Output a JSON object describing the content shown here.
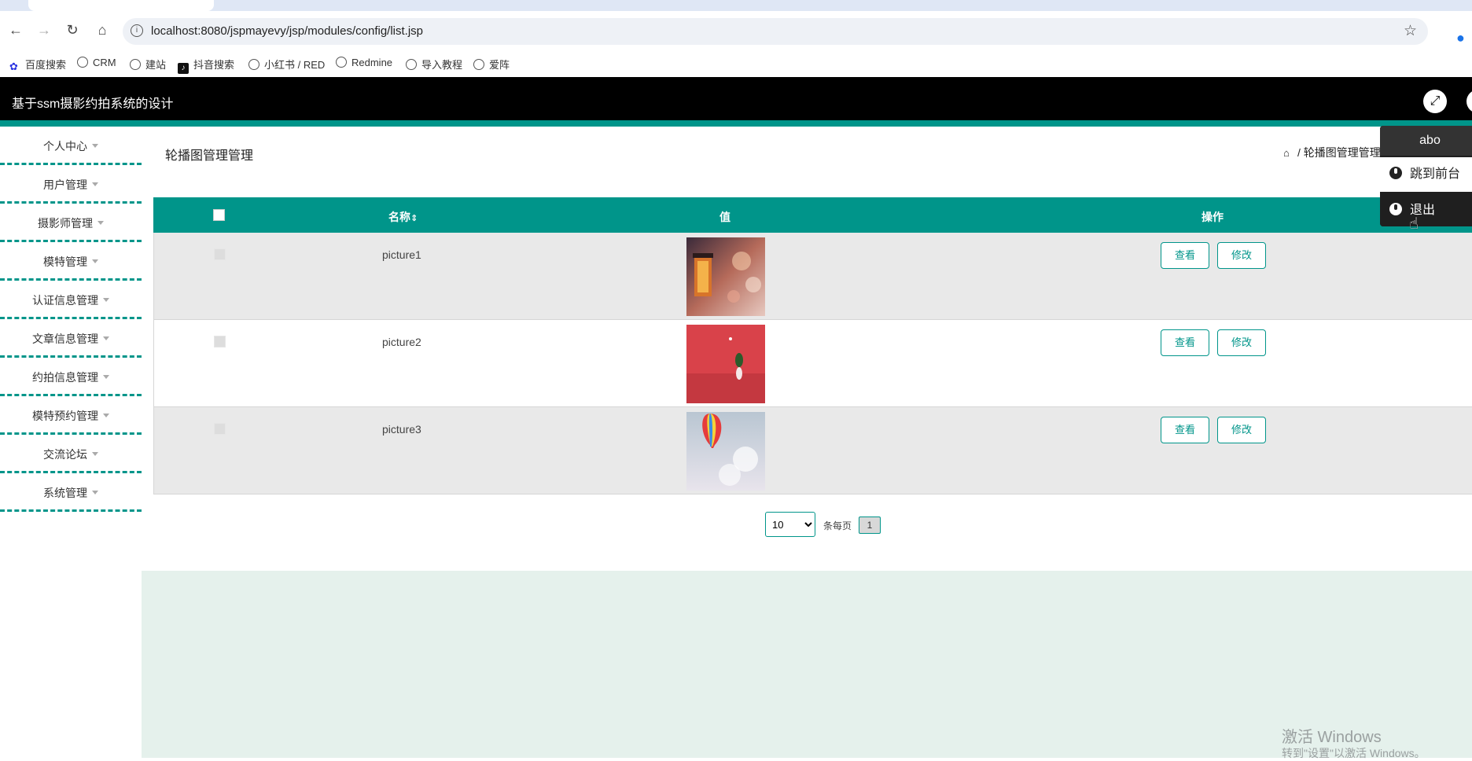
{
  "browser": {
    "tab_title": "基于ssm摄影约拍系统的设计",
    "url": "localhost:8080/jspmayevy/jsp/modules/config/list.jsp",
    "bookmarks": [
      "百度搜索",
      "CRM",
      "建站",
      "抖音搜索",
      "小红书 / RED",
      "Redmine",
      "导入教程",
      "爱阵"
    ]
  },
  "header": {
    "title": "基于ssm摄影约拍系统的设计"
  },
  "sidebar": {
    "items": [
      "个人中心",
      "用户管理",
      "摄影师管理",
      "模特管理",
      "认证信息管理",
      "文章信息管理",
      "约拍信息管理",
      "模特预约管理",
      "交流论坛",
      "系统管理"
    ]
  },
  "page": {
    "title": "轮播图管理管理",
    "breadcrumb": "/ 轮播图管理管理"
  },
  "table": {
    "headers": {
      "name": "名称",
      "sort": "⇕",
      "value": "值",
      "action": "操作"
    },
    "rows": [
      {
        "name": "picture1",
        "thumb": "lantern-bokeh"
      },
      {
        "name": "picture2",
        "thumb": "red-figure"
      },
      {
        "name": "picture3",
        "thumb": "hot-air-balloon"
      }
    ],
    "view_label": "查看",
    "edit_label": "修改"
  },
  "pager": {
    "page_size": "10",
    "per_page_label": "条每页",
    "current_page": "1"
  },
  "user_menu": {
    "username": "abo",
    "front_label": "跳到前台",
    "logout_label": "退出"
  },
  "watermark": {
    "line1": "激活 Windows",
    "line2": "转到\"设置\"以激活 Windows。"
  },
  "colors": {
    "accent": "#00958a",
    "header_bg": "#000000",
    "footer_bg": "#e5f1ec"
  }
}
